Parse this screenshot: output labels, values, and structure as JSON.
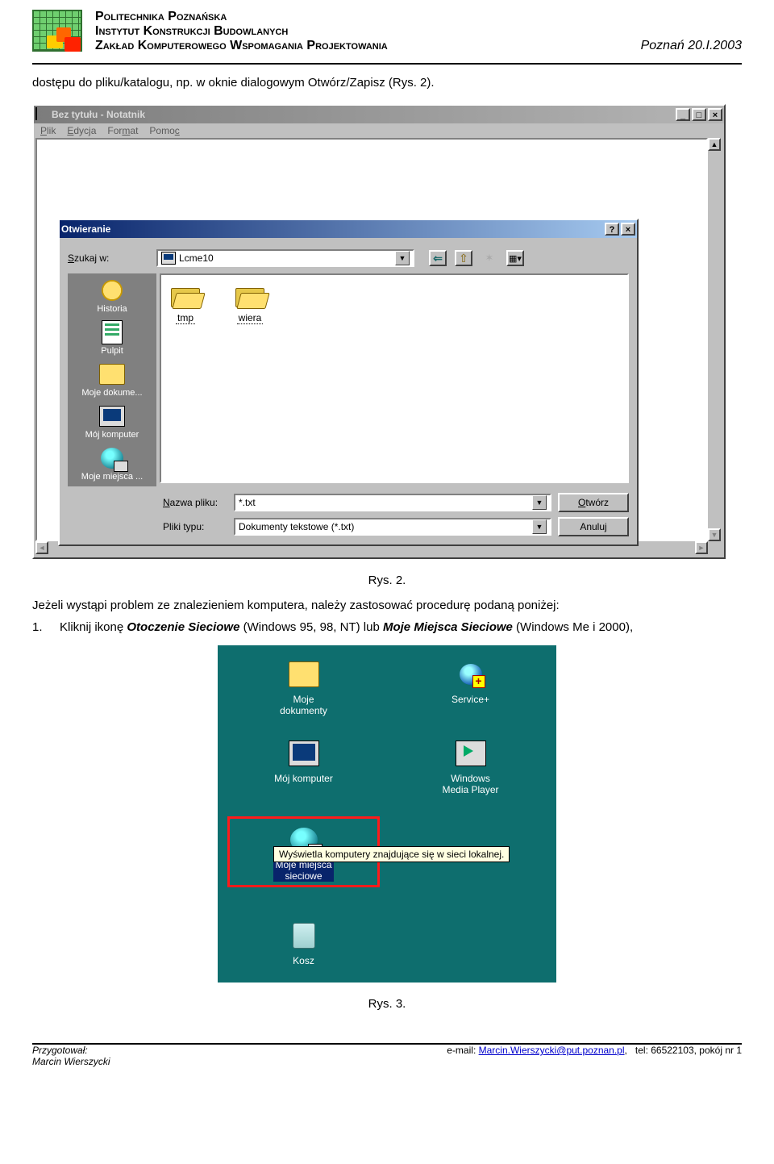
{
  "header": {
    "line1": "Politechnika Poznańska",
    "line2": "Instytut Konstrukcji Budowlanych",
    "line3": "Zakład Komputerowego Wspomagania Projektowania",
    "right": "Poznań 20.I.2003"
  },
  "intro_text": "dostępu do pliku/katalogu, np. w oknie dialogowym Otwórz/Zapisz (Rys. 2).",
  "notepad": {
    "title": "Bez tytułu - Notatnik",
    "menus": {
      "file": "Plik",
      "edit": "Edycja",
      "format": "Format",
      "help": "Pomoc"
    },
    "win_btn_min": "_",
    "win_btn_max": "□",
    "win_btn_close": "×"
  },
  "open_dialog": {
    "title": "Otwieranie",
    "help_btn": "?",
    "close_btn": "×",
    "lookin_label": "Szukaj w:",
    "lookin_value": "Lcme10",
    "nav": {
      "back": "⇐",
      "up": "⇧",
      "new": "✶",
      "view": "▦▾"
    },
    "places": [
      {
        "label": "Historia",
        "icon": "clock"
      },
      {
        "label": "Pulpit",
        "icon": "doc"
      },
      {
        "label": "Moje dokume...",
        "icon": "folder"
      },
      {
        "label": "Mój komputer",
        "icon": "monitor"
      },
      {
        "label": "Moje miejsca ...",
        "icon": "globe"
      }
    ],
    "files": [
      {
        "name": "tmp"
      },
      {
        "name": "wiera"
      }
    ],
    "filename_label": "Nazwa pliku:",
    "type_label": "Pliki typu:",
    "filename_value": "*.txt",
    "type_value": "Dokumenty tekstowe (*.txt)",
    "open_btn": "Otwórz",
    "cancel_btn": "Anuluj"
  },
  "caption1": "Rys. 2.",
  "para2": "Jeżeli wystąpi problem ze znalezieniem komputera, należy zastosować procedurę podaną poniżej:",
  "step1": {
    "num": "1.",
    "pre": "Kliknij ikonę ",
    "em1": "Otoczenie Sieciowe",
    "mid": " (Windows 95, 98, NT) lub ",
    "em2": "Moje Miejsca Sieciowe",
    "post": " (Windows Me i 2000),"
  },
  "desktop": {
    "items": [
      {
        "label": "Moje\ndokumenty",
        "icon": "folder"
      },
      {
        "label": "Service+",
        "icon": "plus"
      },
      {
        "label": "Mój komputer",
        "icon": "monitor"
      },
      {
        "label": "Windows\nMedia Player",
        "icon": "play"
      }
    ],
    "highlight": {
      "label": "Moje miejsca\nsieciowe",
      "icon": "globe"
    },
    "tooltip": "Wyświetla komputery znajdujące się w sieci lokalnej.",
    "bin": {
      "label": "Kosz",
      "icon": "bin"
    }
  },
  "caption2": "Rys. 3.",
  "footer": {
    "prep_label": "Przygotował:",
    "author": "Marcin Wierszycki",
    "email_label": "e-mail: ",
    "email": "Marcin.Wierszycki@put.poznan.pl",
    "email_comma": ",",
    "phone": "tel: 66522103, pokój nr 1"
  }
}
